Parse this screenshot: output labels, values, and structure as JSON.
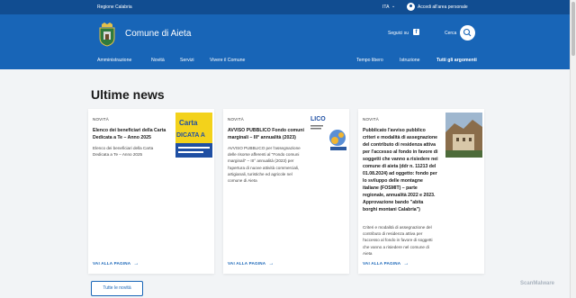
{
  "slim_header": {
    "region": "Regione Calabria",
    "language": "ITA",
    "login": "Accedi all'area personale"
  },
  "header": {
    "title": "Comune di Aieta",
    "follow_label": "Seguici su",
    "facebook": "f",
    "search_label": "Cerca"
  },
  "nav": {
    "items": [
      "Amministrazione",
      "Novità",
      "Servizi",
      "Vivere il Comune"
    ],
    "secondary": [
      "Tempo libero",
      "Istruzione",
      "Tutti gli argomenti"
    ]
  },
  "main": {
    "section_title": "Ultime news",
    "all_news_button": "Tutte le novità",
    "cards": [
      {
        "category": "NOVITÀ",
        "title_lines": [
          "Elenco dei beneficiari della Carta",
          "Dedicata a Te – Anno 2025"
        ],
        "desc_lines": [
          "Elenco dei beneficiari della Carta",
          "Dedicata a Te – Anno 2025"
        ],
        "more": "VAI ALLA PAGINA",
        "thumb_text_1": "Carta",
        "thumb_text_2": "DICATA A"
      },
      {
        "category": "NOVITÀ",
        "title_lines": [
          "AVVISO PUBBLICO Fondo comuni",
          "marginali – III° annualità (2023)"
        ],
        "desc_lines": [
          "AVVISO PUBBLICO per l'assegnazione",
          "delle risorse afferenti al \"Fondo comuni",
          "marginali\" – III° annualità (2023) per",
          "l'apertura di nuove attività commerciali,",
          "artigianali, turistiche ed agricole nel",
          "comune di Aieta"
        ],
        "more": "VAI ALLA PAGINA",
        "thumb_text_1": "LICO"
      },
      {
        "category": "NOVITÀ",
        "title_lines": [
          "Pubblicato l'avviso pubblico",
          "criteri e modalità di assegnazione",
          "del contributo di residenza attiva",
          "per l'accesso al fondo in favore di",
          "soggetti che vanno a risiedere nei",
          "comune di aieta (ddr n. 11213 del",
          "01.08.2024) ad oggetto: fondo per",
          "lo sviluppo delle montagne",
          "italiane (FOSMIT) – parte",
          "regionale, annualità 2022 e 2023.",
          "Approvazione bando \"abita",
          "borghi montani Calabria\")"
        ],
        "desc_lines": [
          "Criteri e modalità di assegnazione del",
          "contributo di residenza attiva per",
          "l'accesso al fondo in favore di soggetti",
          "che vanno a risiedere nel comune di",
          "Aieta"
        ],
        "more": "VAI ALLA PAGINA"
      }
    ]
  },
  "watermark": "ScanMalware",
  "colors": {
    "slim": "#114d91",
    "header": "#1865b7",
    "accent": "#1865b7",
    "background": "#f2f4f6"
  }
}
